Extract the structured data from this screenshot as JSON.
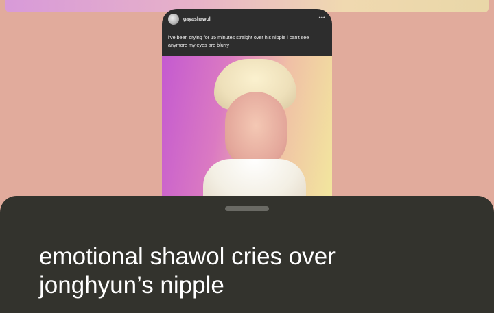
{
  "post": {
    "username": "gayashawol",
    "more_icon": "more-dots-icon",
    "more_glyph": "•••",
    "text": "i've been crying for 15 minutes straight over his nipple i can't see anymore my eyes are blurry"
  },
  "sheet": {
    "title": "emotional shawol cries over\njonghyun’s nipple"
  },
  "colors": {
    "background": "#e1ab9c",
    "sheet": "#33332d",
    "card": "#2d2d2d"
  }
}
